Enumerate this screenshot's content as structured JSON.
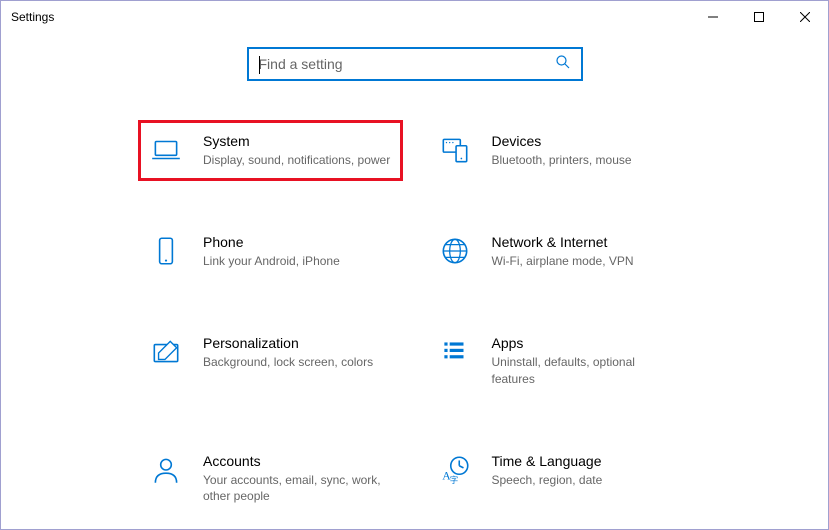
{
  "window": {
    "title": "Settings"
  },
  "search": {
    "placeholder": "Find a setting",
    "value": ""
  },
  "categories": [
    {
      "id": "system",
      "title": "System",
      "desc": "Display, sound, notifications, power",
      "highlighted": true
    },
    {
      "id": "devices",
      "title": "Devices",
      "desc": "Bluetooth, printers, mouse"
    },
    {
      "id": "phone",
      "title": "Phone",
      "desc": "Link your Android, iPhone"
    },
    {
      "id": "network",
      "title": "Network & Internet",
      "desc": "Wi-Fi, airplane mode, VPN"
    },
    {
      "id": "personalization",
      "title": "Personalization",
      "desc": "Background, lock screen, colors"
    },
    {
      "id": "apps",
      "title": "Apps",
      "desc": "Uninstall, defaults, optional features"
    },
    {
      "id": "accounts",
      "title": "Accounts",
      "desc": "Your accounts, email, sync, work, other people"
    },
    {
      "id": "time",
      "title": "Time & Language",
      "desc": "Speech, region, date"
    }
  ]
}
